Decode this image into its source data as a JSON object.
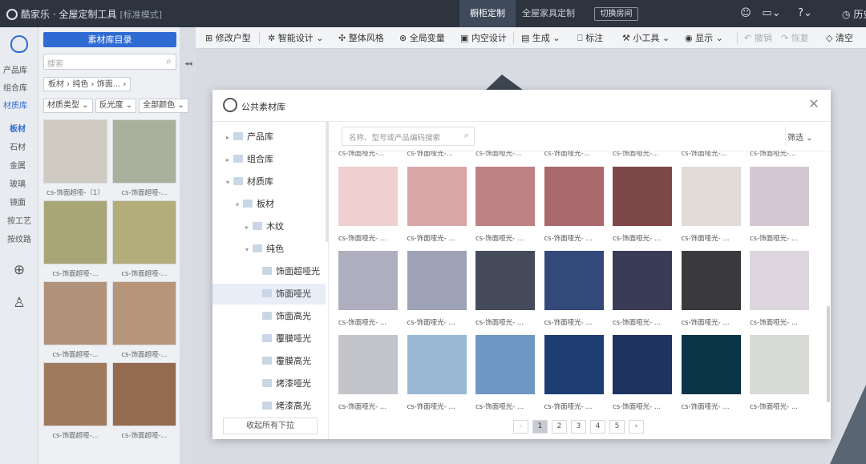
{
  "topbar": {
    "brand": "酷家乐 · 全屋定制工具",
    "mode": "[标准模式]",
    "tab_active": "橱柜定制",
    "tab_2": "全屋家具定制",
    "switch_room": "切换房间",
    "history": "历史",
    "icons": [
      "user-icon",
      "screen-icon",
      "help-icon",
      "clock-icon"
    ]
  },
  "rail": {
    "categories": [
      "产品库",
      "组合库",
      "材质库"
    ],
    "subcategories": [
      "板材",
      "石材",
      "金属",
      "玻璃",
      "镜面",
      "按工艺",
      "按纹路"
    ]
  },
  "panel": {
    "dir_button": "素材库目录",
    "search_placeholder": "搜索",
    "breadcrumb": "板材 › 纯色 › 饰面... ›",
    "filters": [
      "材质类型 ⌄",
      "反光度 ⌄",
      "全部颜色 ⌄"
    ],
    "swatches": [
      {
        "label": "cs-饰面超哑-（1）",
        "color": "#cfcbc2"
      },
      {
        "label": "cs-饰面超哑-...",
        "color": "#a9b09b"
      },
      {
        "label": "cs-饰面超哑-...",
        "color": "#a8a677"
      },
      {
        "label": "cs-饰面超哑-...",
        "color": "#b3ad7c"
      },
      {
        "label": "cs-饰面超哑-...",
        "color": "#b2927b"
      },
      {
        "label": "cs-饰面超哑-...",
        "color": "#b6957a"
      },
      {
        "label": "cs-饰面超哑-...",
        "color": "#a07a5d"
      },
      {
        "label": "cs-饰面超哑-...",
        "color": "#946b4e"
      }
    ]
  },
  "toolbar": {
    "items": [
      "修改户型",
      "智能设计",
      "整体风格",
      "全局变量",
      "内空设计",
      "生成",
      "标注",
      "小工具",
      "显示"
    ],
    "disabled": [
      "撤销",
      "恢复"
    ],
    "clear": "清空"
  },
  "modal": {
    "title": "公共素材库",
    "tree": [
      {
        "label": "产品库",
        "indent": 0,
        "arrow": "▸"
      },
      {
        "label": "组合库",
        "indent": 0,
        "arrow": "▸"
      },
      {
        "label": "材质库",
        "indent": 0,
        "arrow": "▾"
      },
      {
        "label": "板材",
        "indent": 1,
        "arrow": "▾"
      },
      {
        "label": "木纹",
        "indent": 2,
        "arrow": "▸"
      },
      {
        "label": "纯色",
        "indent": 2,
        "arrow": "▾"
      },
      {
        "label": "饰面超哑光",
        "indent": 3,
        "arrow": ""
      },
      {
        "label": "饰面哑光",
        "indent": 3,
        "arrow": ""
      },
      {
        "label": "饰面高光",
        "indent": 3,
        "arrow": ""
      },
      {
        "label": "覆膜哑光",
        "indent": 3,
        "arrow": ""
      },
      {
        "label": "覆膜高光",
        "indent": 3,
        "arrow": ""
      },
      {
        "label": "烤漆哑光",
        "indent": 3,
        "arrow": ""
      },
      {
        "label": "烤漆高光",
        "indent": 3,
        "arrow": ""
      }
    ],
    "collapse_all": "收起所有下拉",
    "search_placeholder": "名称、型号或产品编码搜索",
    "filter": "筛选 ⌄",
    "top_label": "cs-饰面哑光-...",
    "swatch_label": "cs-饰面哑光- ...",
    "swatches": [
      "#efcfcf",
      "#d9a6a8",
      "#be8184",
      "#a9686c",
      "#7e4848",
      "#e2dcd8",
      "#d5c8d3",
      "#aeaebf",
      "#9ea2b6",
      "#454b5a",
      "#33497a",
      "#3a3b57",
      "#3a3a3e",
      "#ddd6de",
      "#c4c5cb",
      "#98b8d4",
      "#6f97c4",
      "#1e3d72",
      "#1e3360",
      "#0c3447",
      "#d9dbd6"
    ],
    "pages": [
      "‹",
      "1",
      "2",
      "3",
      "4",
      "5",
      "›"
    ]
  }
}
